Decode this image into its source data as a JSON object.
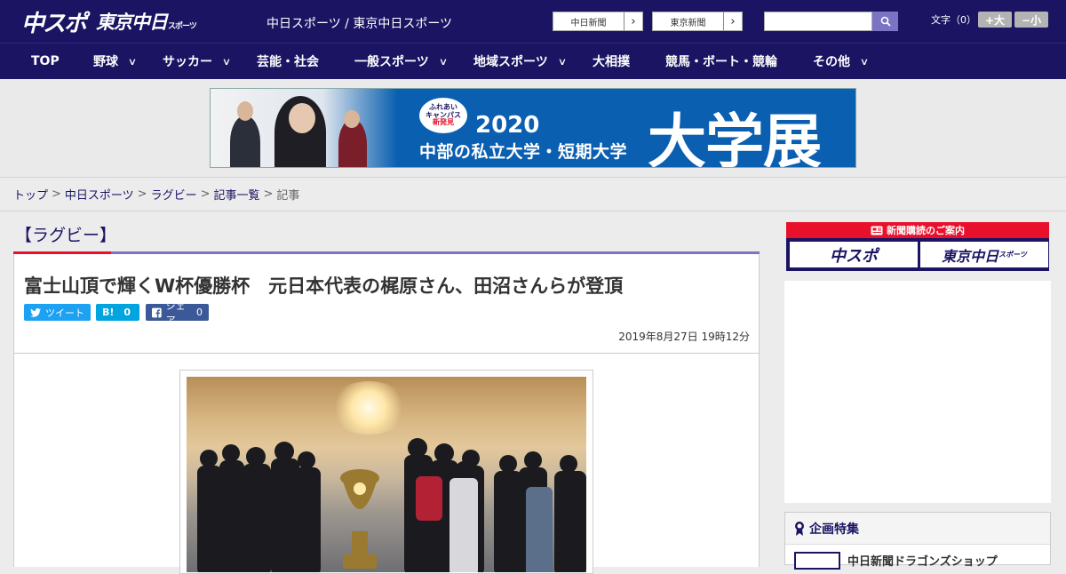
{
  "header": {
    "logo_main": "中スポ",
    "logo_tokyo": "東京中日",
    "logo_tokyo_suffix": "スポーツ",
    "site_title": "中日スポーツ / 東京中日スポーツ",
    "paper_links": [
      "中日新聞",
      "東京新聞"
    ],
    "search": {
      "placeholder": ""
    },
    "font_size": {
      "label": "文字（0）",
      "increase": "+大",
      "decrease": "−小"
    }
  },
  "nav": {
    "items": [
      {
        "label": "TOP",
        "dropdown": false
      },
      {
        "label": "野球",
        "dropdown": true
      },
      {
        "label": "サッカー",
        "dropdown": true
      },
      {
        "label": "芸能・社会",
        "dropdown": false
      },
      {
        "label": "一般スポーツ",
        "dropdown": true
      },
      {
        "label": "地域スポーツ",
        "dropdown": true
      },
      {
        "label": "大相撲",
        "dropdown": false
      },
      {
        "label": "競馬・ボート・競輪",
        "dropdown": false
      },
      {
        "label": "その他",
        "dropdown": true
      }
    ]
  },
  "banner": {
    "badge": [
      "ふれあい",
      "キャンパス",
      "新発見"
    ],
    "year": "2020",
    "subtitle": "中部の私立大学・短期大学",
    "main": "大学展"
  },
  "breadcrumb": {
    "items": [
      "トップ",
      "中日スポーツ",
      "ラグビー",
      "記事一覧"
    ],
    "current": "記事",
    "separator": ">"
  },
  "article": {
    "category": "【ラグビー】",
    "title": "富士山頂で輝くW杯優勝杯　元日本代表の梶原さん、田沼さんらが登頂",
    "share": {
      "tweet_label": "ツイート",
      "hatena_label": "B!",
      "hatena_count": "0",
      "facebook_label": "シェア",
      "facebook_count": "0"
    },
    "date": "2019年8月27日 19時12分"
  },
  "sidebar": {
    "subscribe_title": "新聞購読のご案内",
    "subscribe_logos": [
      "中スポ",
      "東京中日"
    ],
    "subscribe_logo_suffix": "スポーツ",
    "feature_title": "企画特集",
    "feature_item": "中日新聞ドラゴンズショップ"
  },
  "colors": {
    "navy": "#1a1463",
    "accent_purple": "#7b73c4",
    "accent_red": "#e8102a",
    "twitter": "#1da1f2",
    "hatena": "#00a4de",
    "facebook": "#3b5998"
  }
}
